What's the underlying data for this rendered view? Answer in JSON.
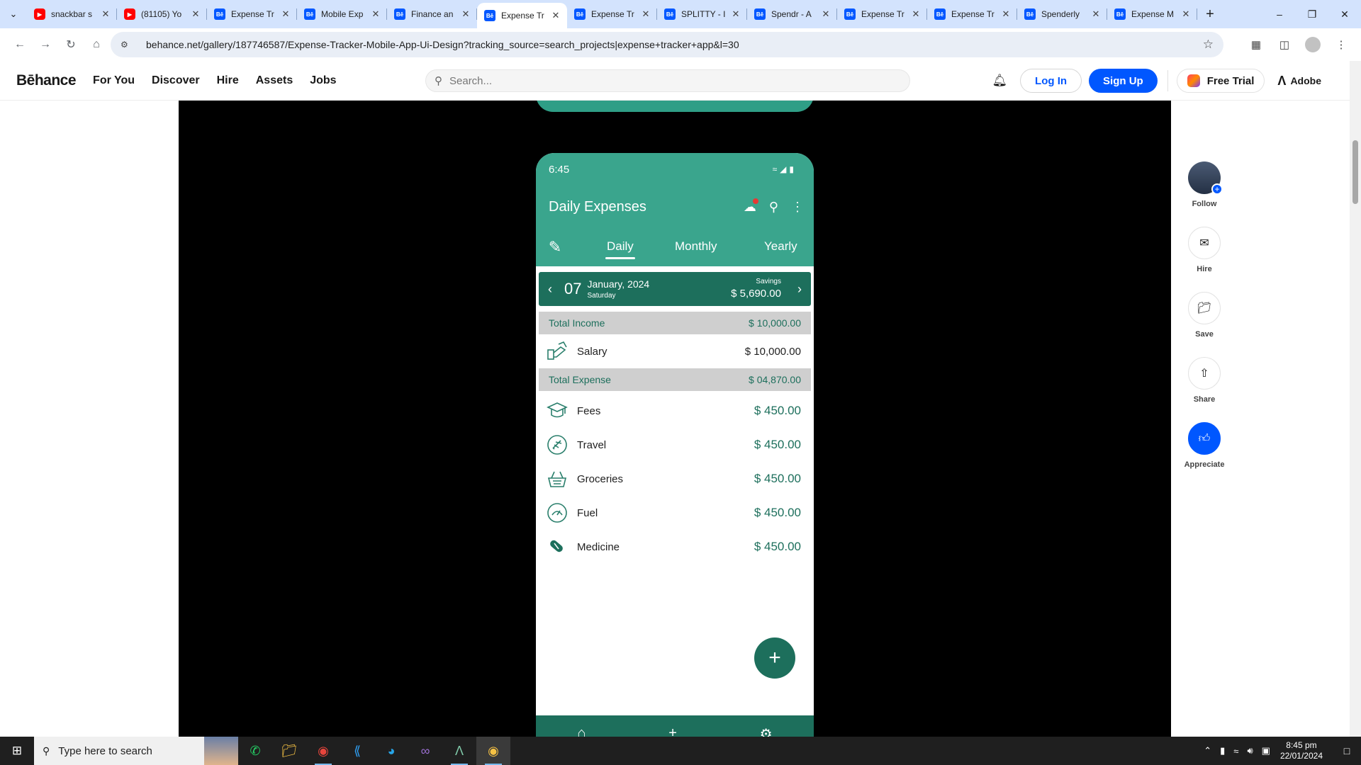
{
  "browser": {
    "tabs": [
      {
        "title": "snackbar s",
        "favicon": "youtube-icon"
      },
      {
        "title": "(81105) Yo",
        "favicon": "youtube-icon"
      },
      {
        "title": "Expense Tr",
        "favicon": "behance-icon"
      },
      {
        "title": "Mobile Exp",
        "favicon": "behance-icon"
      },
      {
        "title": "Finance an",
        "favicon": "behance-icon"
      },
      {
        "title": "Expense Tr",
        "favicon": "behance-icon",
        "active": true
      },
      {
        "title": "Expense Tr",
        "favicon": "behance-icon"
      },
      {
        "title": "SPLITTY - I",
        "favicon": "behance-icon"
      },
      {
        "title": "Spendr - A",
        "favicon": "behance-icon"
      },
      {
        "title": "Expense Tr",
        "favicon": "behance-icon"
      },
      {
        "title": "Expense Tr",
        "favicon": "behance-icon"
      },
      {
        "title": "Spenderly",
        "favicon": "behance-icon"
      },
      {
        "title": "Expense M",
        "favicon": "behance-icon"
      }
    ],
    "favicon_text": "Bē",
    "url": "behance.net/gallery/187746587/Expense-Tracker-Mobile-App-Ui-Design?tracking_source=search_projects|expense+tracker+app&l=30"
  },
  "behance": {
    "logo": "Bēhance",
    "nav": [
      "For You",
      "Discover",
      "Hire",
      "Assets",
      "Jobs"
    ],
    "search_placeholder": "Search...",
    "login": "Log In",
    "signup": "Sign Up",
    "free_trial": "Free Trial",
    "adobe": "Adobe"
  },
  "phone": {
    "time": "6:45",
    "title": "Daily Expenses",
    "tabs": [
      "Daily",
      "Monthly",
      "Yearly"
    ],
    "selected_tab": "Daily",
    "date_day": "07",
    "date_month": "January, 2024",
    "date_weekday": "Saturday",
    "savings_label": "Savings",
    "savings_value": "$ 5,690.00",
    "total_income_label": "Total Income",
    "total_income_value": "$ 10,000.00",
    "income_items": [
      {
        "label": "Salary",
        "value": "$ 10,000.00",
        "icon": "salary-icon"
      }
    ],
    "total_expense_label": "Total Expense",
    "total_expense_value": "$ 04,870.00",
    "expense_items": [
      {
        "label": "Fees",
        "value": "$ 450.00",
        "icon": "graduation-cap-icon"
      },
      {
        "label": "Travel",
        "value": "$ 450.00",
        "icon": "airplane-icon"
      },
      {
        "label": "Groceries",
        "value": "$ 450.00",
        "icon": "basket-icon"
      },
      {
        "label": "Fuel",
        "value": "$ 450.00",
        "icon": "fuel-gauge-icon"
      },
      {
        "label": "Medicine",
        "value": "$ 450.00",
        "icon": "pill-icon"
      }
    ],
    "colors": {
      "primary": "#3aa58d",
      "dark": "#1d6f5c",
      "summary_bg": "#cfcfcf"
    }
  },
  "rail": {
    "follow": "Follow",
    "hire": "Hire",
    "save": "Save",
    "share": "Share",
    "appreciate": "Appreciate"
  },
  "taskbar": {
    "search_placeholder": "Type here to search",
    "time": "8:45 pm",
    "date": "22/01/2024"
  }
}
